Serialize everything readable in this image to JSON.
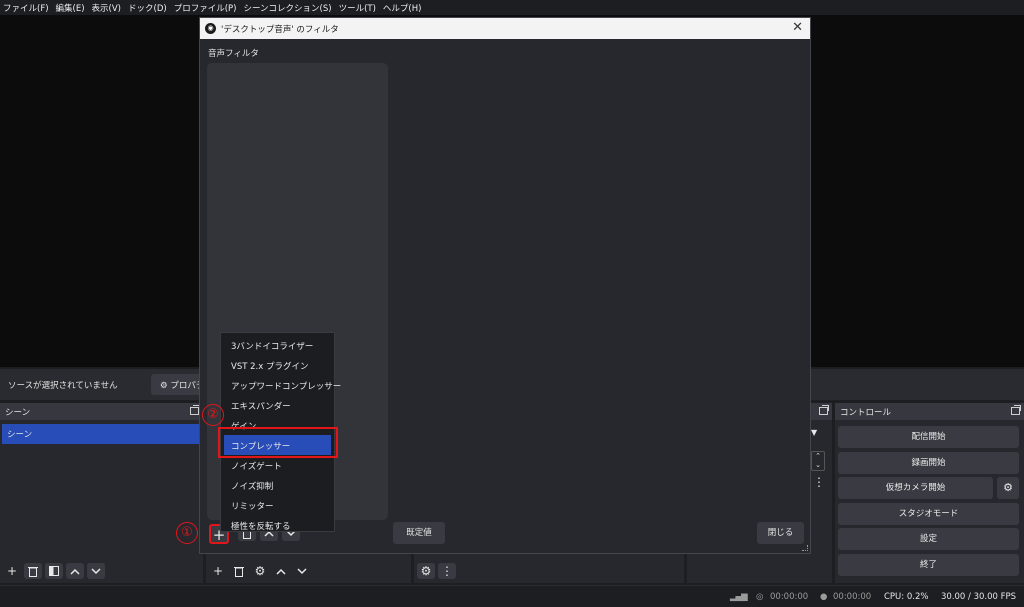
{
  "menubar": [
    "ファイル(F)",
    "編集(E)",
    "表示(V)",
    "ドック(D)",
    "プロファイル(P)",
    "シーンコレクション(S)",
    "ツール(T)",
    "ヘルプ(H)"
  ],
  "source_bar": {
    "message": "ソースが選択されていません",
    "properties_label": "⚙ プロパティ"
  },
  "scenes_dock": {
    "title": "シーン",
    "selected_scene": "シーン"
  },
  "controls_dock": {
    "title": "コントロール",
    "buttons": [
      "配信開始",
      "録画開始",
      "仮想カメラ開始",
      "スタジオモード",
      "設定",
      "終了"
    ]
  },
  "statusbar": {
    "stream_time": "00:00:00",
    "rec_time": "00:00:00",
    "cpu": "CPU: 0.2%",
    "fps": "30.00 / 30.00 FPS"
  },
  "dialog": {
    "title": "'デスクトップ音声' のフィルタ",
    "section_label": "音声フィルタ",
    "defaults_button": "既定値",
    "close_button": "閉じる"
  },
  "filter_menu": {
    "items": [
      "3バンドイコライザー",
      "VST 2.x プラグイン",
      "アップワードコンプレッサー",
      "エキスパンダー",
      "ゲイン",
      "コンプレッサー",
      "ノイズゲート",
      "ノイズ抑制",
      "リミッター",
      "極性を反転する"
    ],
    "selected": "コンプレッサー"
  },
  "annotations": {
    "step1": "①",
    "step2": "②"
  },
  "colors": {
    "accent": "#284cb8",
    "annotation": "#e0161b"
  }
}
